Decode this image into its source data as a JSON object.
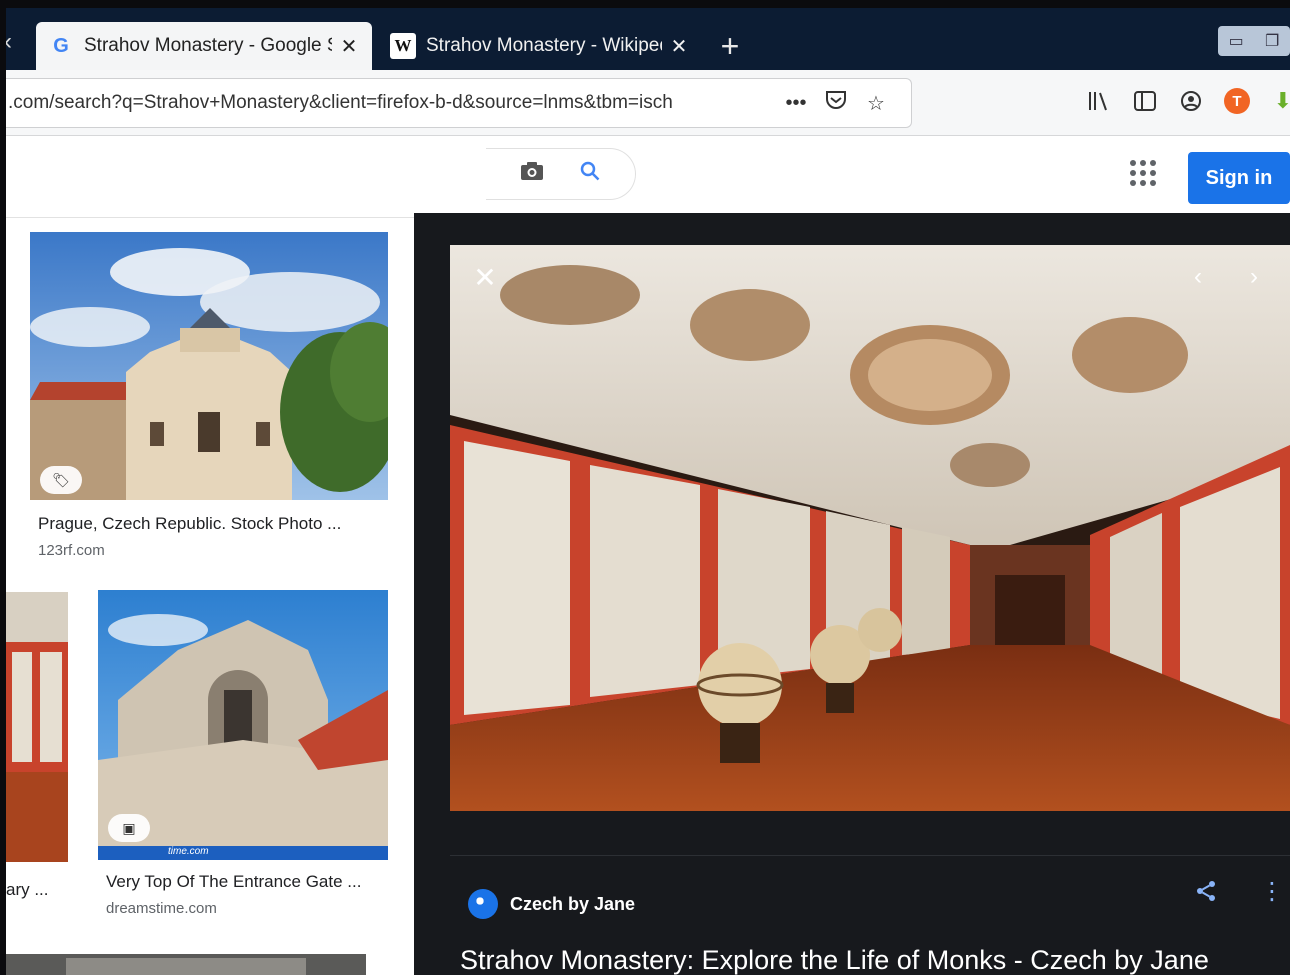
{
  "browser": {
    "tabs": [
      {
        "favicon": "G",
        "title": "Strahov Monastery - Google Se",
        "close": "✕",
        "active": true
      },
      {
        "favicon": "W",
        "title": "Strahov Monastery - Wikipedia",
        "close": "✕",
        "active": false
      }
    ],
    "new_tab": "+",
    "url": ".com/search?q=Strahov+Monastery&client=firefox-b-d&source=lnms&tbm=isch",
    "url_buttons": [
      "•••",
      "pocket-icon",
      "bookmark-star-icon"
    ],
    "toolbar_icons": [
      "library-icon",
      "sidebar-icon",
      "account-icon",
      "extension-t-icon",
      "download-extension-icon"
    ],
    "extension_letter": "T"
  },
  "google": {
    "sign_in_label": "Sign in",
    "icons": [
      "camera-icon",
      "search-icon",
      "apps-grid-icon"
    ]
  },
  "results": [
    {
      "title": "Prague, Czech Republic. Stock Photo ...",
      "source": "123rf.com",
      "badge_icon": "tag-icon"
    },
    {
      "title": "ary ...",
      "source": ""
    },
    {
      "title": "Very Top Of The Entrance Gate ...",
      "source": "dreamstime.com",
      "badge_icon": "image-icon",
      "watermark": "time.com"
    }
  ],
  "preview": {
    "source_name": "Czech by Jane",
    "title": "Strahov Monastery: Explore the Life of Monks - Czech by Jane",
    "close": "✕",
    "prev": "‹",
    "next": "›"
  },
  "colors": {
    "tab_strip": "#0c1c33",
    "sign_in_button": "#1a73e8",
    "preview_panel": "#17191d",
    "bookshelf_red": "#c8432c",
    "floor_wood": "#a8441e"
  }
}
